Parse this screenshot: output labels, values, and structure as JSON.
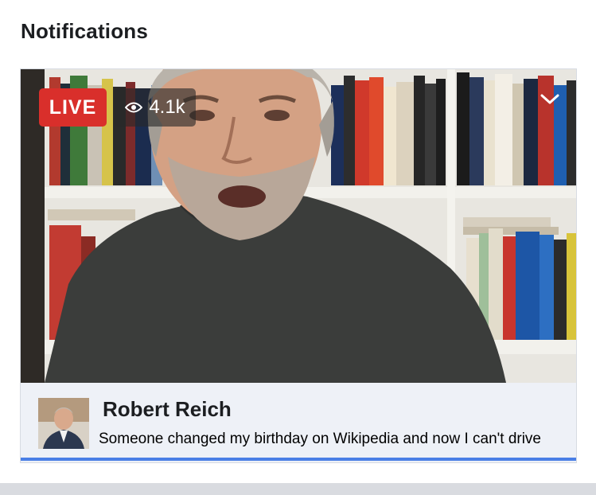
{
  "header": {
    "title": "Notifications"
  },
  "video": {
    "live_label": "LIVE",
    "viewer_count": "4.1k",
    "viewer_icon": "eye-icon",
    "menu_icon": "chevron-down-icon",
    "progress_percent": 100
  },
  "broadcast": {
    "name": "Robert Reich",
    "caption": "Someone changed my birthday on Wikipedia and now I can't drive"
  },
  "colors": {
    "live_red": "#d92f2b",
    "progress_blue": "#4a7fe6",
    "info_background": "#eef1f7"
  }
}
